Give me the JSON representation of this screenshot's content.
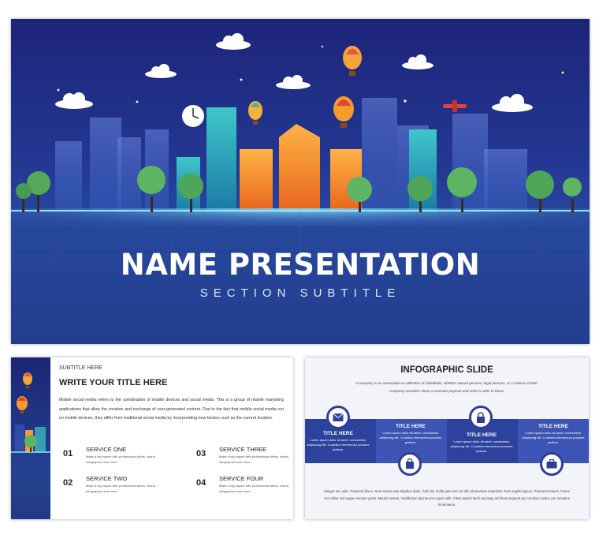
{
  "main_slide": {
    "title": "NAME PRESENTATION",
    "subtitle": "SECTION SUBTITLE"
  },
  "slide_2": {
    "subtitle": "SUBTITLE HERE",
    "title": "WRITE YOUR TITLE HERE",
    "body": "Mobile social media refers to the combination of mobile devices and social media. This is a group of mobile marketing applications that allow the creation and exchange of user-generated content. Due to the fact that mobile social media run on mobile devices, they differ from traditional social media by incorporating new factors such as the current location.",
    "services": [
      {
        "number": "01",
        "title": "SERVICE ONE",
        "desc": "Make a big impact with professional slides, charts, infographics and more."
      },
      {
        "number": "02",
        "title": "SERVICE TWO",
        "desc": "Make a big impact with professional slides, charts, infographics and more."
      },
      {
        "number": "03",
        "title": "SERVICE THREE",
        "desc": "Make a big impact with professional slides, charts, infographics and more."
      },
      {
        "number": "04",
        "title": "SERVICE FOUR",
        "desc": "Make a big impact with professional slides, charts, infographics and more."
      }
    ]
  },
  "slide_3": {
    "title": "INFOGRAPHIC SLIDE",
    "intro_1": "A company is an association or collection of individuals, whether natural persons, legal persons, or a mixture of both.",
    "intro_2": "Company members share a common purpose and unite in order to focus.",
    "items": [
      {
        "title": "TITLE HERE",
        "desc": "Lorem ipsum dolor sit amet, consectetur adipiscing elit. Curabitur elementum posuere pretium.",
        "icon": "envelope-icon"
      },
      {
        "title": "TITLE HERE",
        "desc": "Lorem ipsum dolor sit amet, consectetur adipiscing elit. Curabitur elementum posuere pretium.",
        "icon": "shopping-bag-icon"
      },
      {
        "title": "TITLE HERE",
        "desc": "Lorem ipsum dolor sit amet, consectetur adipiscing elit. Curabitur elementum posuere pretium.",
        "icon": "lock-icon"
      },
      {
        "title": "TITLE HERE",
        "desc": "Lorem ipsum dolor sit amet, consectetur adipiscing elit. Curabitur elementum posuere pretium.",
        "icon": "briefcase-icon"
      }
    ],
    "outro": "Integer nec odio. Praesent libero. Sed cursus ante dapibus diam. Sed nisi. Nulla quis sem at nibh elementum imperdiet. Duis sagittis ipsum. Praesent mauris. Fusce nec tellus sed augue semper porta. Mauris massa. Vestibulum lacinia arcu eget nulla. Class aptent taciti sociosqu ad litora torquent per conubia nostra, per inceptos himenaeos."
  },
  "colors": {
    "night_sky": "#1d2478",
    "infographic_band": "#3c55b4",
    "building_orange": "#f59a2c"
  }
}
